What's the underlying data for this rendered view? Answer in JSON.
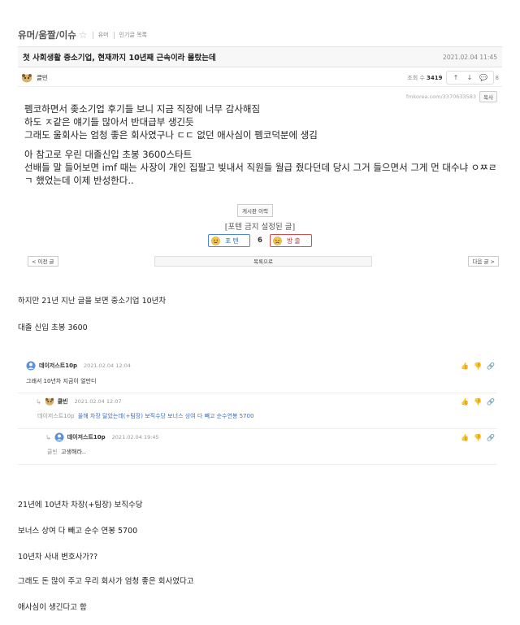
{
  "post": {
    "board_name": "유머/움짤/이슈",
    "crumbs": [
      "유머",
      "인기글 목록"
    ],
    "title": "첫 사회생활 중소기업, 현재까지 10년째 근속이라 몰랐는데",
    "date": "2021.02.04 11:45",
    "author": "클빈",
    "views_label": "조회 수",
    "views": "3419",
    "actions": [
      "↑",
      "↓",
      "💬"
    ],
    "page_suffix": "8",
    "url": "fmkorea.com/3370633583",
    "copy_label": "복사",
    "body": [
      "펨코하면서 좆소기업 후기들 보니 지금 직장에 너무 감사해짐",
      "하도 ㅈ같은 얘기들 많아서 반대급부 생긴듯",
      "그래도 울회사는 엄청 좋은 회사였구나 ㄷㄷ 없던 애사심이 펨코덕분에 생김",
      "아 참고로 우린 대졸신입 초봉 3600스타트",
      "선배들 말 들어보면 imf 때는 사장이 개인 집팔고 빚내서 직원들 월급 줬다던데 당시 그거 들으면서 그게 먼 대수냐 ㅇㅉㄹ",
      "ㄱ 했었는데 이제 반성한다.."
    ],
    "list_button": "게시판 이력",
    "notice": "[포텐 금지 설정된 글]",
    "vote_up": "포텐",
    "vote_count": "6",
    "vote_down": "방출",
    "prev_button": "< 이전 글",
    "list_nav": "목록으로",
    "next_button": "다음 글 >"
  },
  "commentary_top": [
    "하지만 21년 지난 글을 보면 중소기업 10년차",
    "대졸 신입 초봉 3600"
  ],
  "comments": [
    {
      "name": "데이저스트10p",
      "date": "2021.02.04 12:04",
      "body": "그래서 10년차 지금이 얼만디"
    },
    {
      "name": "클빈",
      "date": "2021.02.04 12:07",
      "mention": "데이저스트10p",
      "body": "올해 차장 달았는데(+팀장) 보직수당 보너스 상여 다 빼고 순수연봉 5700"
    },
    {
      "name": "데이저스트10p",
      "date": "2021.02.04 19:45",
      "mention": "클빈",
      "body": "고생해라.."
    }
  ],
  "comment_actions": [
    "👍",
    "👎",
    "🔗"
  ],
  "commentary_bottom": [
    "21년에 10년차 차장(+팀장) 보직수당",
    "보너스 상여 다 빼고 순수 연봉 5700",
    "10년차 사내 변호사가??",
    "그래도 돈 많이 주고 우리 회사가 엄청 좋은 회사였다고",
    "애사심이 생긴다고 함"
  ],
  "colors": {
    "link": "#3a6fc0",
    "vote_up": "#4a86e0",
    "vote_down": "#d84a4a"
  }
}
